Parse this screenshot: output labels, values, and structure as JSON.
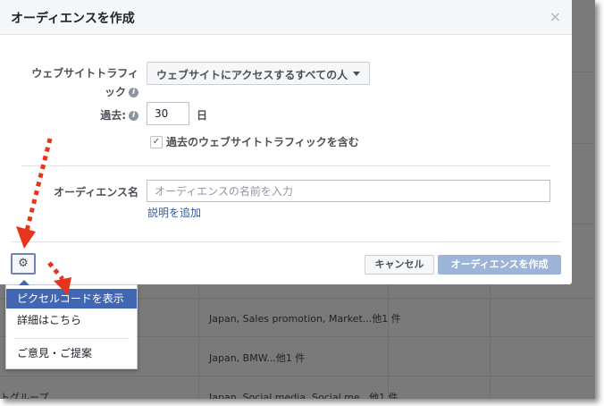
{
  "dialog": {
    "title": "オーディエンスを作成",
    "close_glyph": "×"
  },
  "form": {
    "traffic_label_line1": "ウェブサイトトラフィ",
    "traffic_label_line2": "ック",
    "traffic_selected": "ウェブサイトにアクセスするすべての人",
    "days_label": "過去:",
    "days_value": "30",
    "days_unit": "日",
    "include_past_label": "過去のウェブサイトトラフィックを含む",
    "include_past_checked": true,
    "audience_name_label": "オーディエンス名",
    "audience_name_placeholder": "オーディエンスの名前を入力",
    "add_description": "説明を追加",
    "info_icon_glyph": "i"
  },
  "footer": {
    "gear_icon": "gear-icon",
    "cancel_label": "キャンセル",
    "create_label": "オーディエンスを作成"
  },
  "menu": {
    "items": [
      {
        "label": "ピクセルコードを表示",
        "active": true
      },
      {
        "label": "詳細はこちら",
        "active": false
      },
      {
        "label": "ご意見・ご提案",
        "active": false
      }
    ]
  },
  "background_table": {
    "rows": [
      {
        "col1": "",
        "col2": "Japan, Sales promotion, Market...他1 件"
      },
      {
        "col1": "",
        "col2": "Japan, BMW...他1 件"
      },
      {
        "col1": "トグループ",
        "col2": "Japan, Social media, Social me...他1 件"
      }
    ]
  },
  "colors": {
    "primary": "#4267b2",
    "disabled_primary": "#9cb4d8",
    "link": "#365899",
    "arrow": "#e8341c",
    "overlay": "#7a7a7a"
  }
}
